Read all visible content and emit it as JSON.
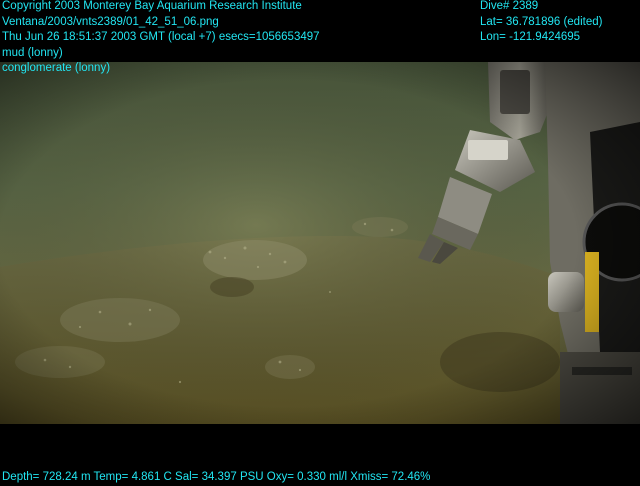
{
  "overlay": {
    "copyright": "Copyright 2003 Monterey Bay Aquarium Research Institute",
    "file_path": "Ventana/2003/vnts2389/01_42_51_06.png",
    "timestamp": "Thu Jun 26 18:51:37 2003 GMT (local +7)  esecs=1056653497",
    "tag1": "mud (lonny)",
    "tag2": "conglomerate (lonny)",
    "dive": "Dive# 2389",
    "lat": "Lat= 36.781896 (edited)",
    "lon": "Lon= -121.9424695",
    "sensors": "Depth= 728.24 m  Temp= 4.861 C  Sal= 34.397 PSU  Oxy= 0.330 ml/l  Xmiss= 72.46%"
  },
  "colors": {
    "overlay_text": "#22e6f2",
    "water": "#5b6b4a",
    "seafloor": "#6e6a3e",
    "robot_arm": "#8c8a80"
  }
}
